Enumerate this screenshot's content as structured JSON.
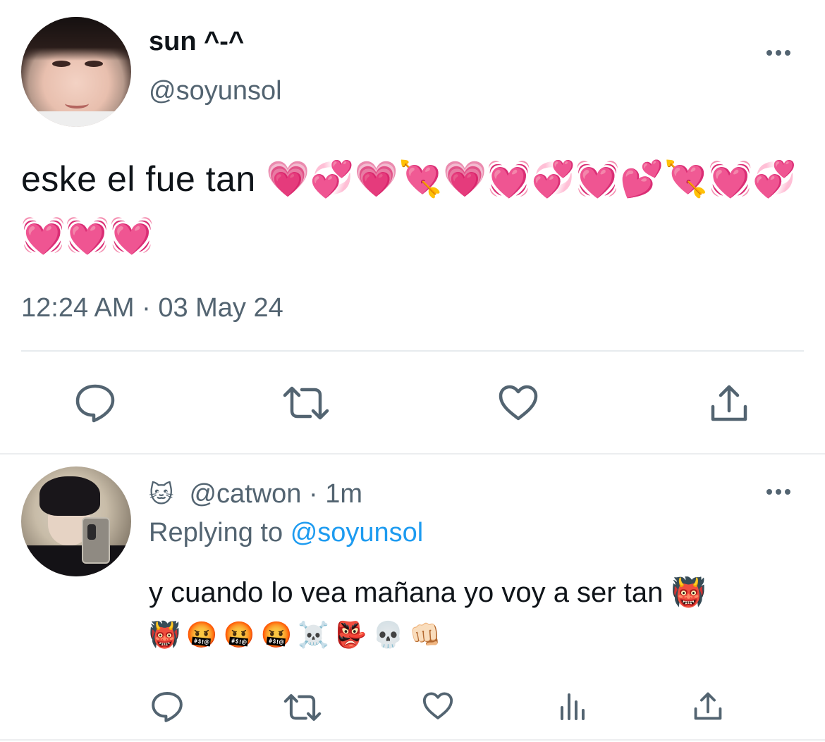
{
  "tweet": {
    "display_name": "sun ^-^",
    "handle": "@soyunsol",
    "text": "eske el fue tan 💗💞💗💘💗💓💞💓💕💘💓💞💓💓💓",
    "timestamp": "12:24 AM · 03 May 24",
    "actions": [
      {
        "name": "reply",
        "icon": "reply-icon"
      },
      {
        "name": "retweet",
        "icon": "retweet-icon"
      },
      {
        "name": "like",
        "icon": "heart-icon"
      },
      {
        "name": "share",
        "icon": "share-icon"
      }
    ]
  },
  "reply": {
    "name_emoji": "🐱",
    "handle": "@catwon",
    "time": "· 1m",
    "replying_label": "Replying to",
    "replying_handle": "@soyunsol",
    "text": "y cuando lo vea mañana yo voy a ser tan 👹",
    "emojis": "👹🤬🤬🤬☠️👺💀👊🏻",
    "actions": [
      {
        "name": "reply",
        "icon": "reply-icon"
      },
      {
        "name": "retweet",
        "icon": "retweet-icon"
      },
      {
        "name": "like",
        "icon": "heart-icon"
      },
      {
        "name": "views",
        "icon": "analytics-icon"
      },
      {
        "name": "share",
        "icon": "share-icon"
      }
    ]
  },
  "colors": {
    "text_primary": "#0f1419",
    "text_secondary": "#536471",
    "link": "#1d9bf0",
    "divider": "#e7ebee"
  }
}
